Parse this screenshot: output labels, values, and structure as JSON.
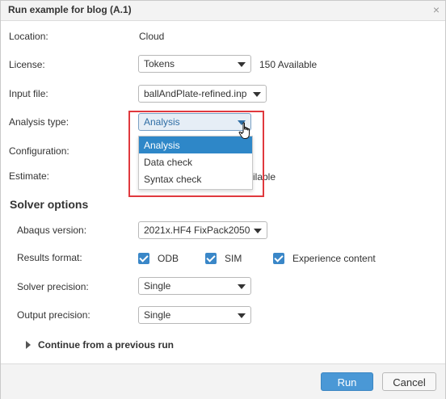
{
  "dialog": {
    "title": "Run example for blog (A.1)",
    "close_glyph": "×"
  },
  "fields": {
    "location_label": "Location:",
    "location_value": "Cloud",
    "license_label": "License:",
    "license_value": "Tokens",
    "license_available": "150 Available",
    "input_file_label": "Input file:",
    "input_file_value": "ballAndPlate-refined.inp",
    "analysis_type_label": "Analysis type:",
    "analysis_type_value": "Analysis",
    "configuration_label": "Configuration:",
    "estimate_label": "Estimate:",
    "estimate_partial_value": "ilable"
  },
  "analysis_dropdown": {
    "options": [
      "Analysis",
      "Data check",
      "Syntax check"
    ],
    "selected": "Analysis"
  },
  "solver_options": {
    "title": "Solver options",
    "abaqus_version_label": "Abaqus version:",
    "abaqus_version_value": "2021x.HF4 FixPack2050",
    "results_format_label": "Results format:",
    "results_formats": [
      {
        "label": "ODB",
        "checked": true
      },
      {
        "label": "SIM",
        "checked": true
      },
      {
        "label": "Experience content",
        "checked": true
      }
    ],
    "solver_precision_label": "Solver precision:",
    "solver_precision_value": "Single",
    "output_precision_label": "Output precision:",
    "output_precision_value": "Single"
  },
  "expander": {
    "label": "Continue from a previous run",
    "icon": "triangle-right-icon"
  },
  "footer": {
    "run_label": "Run",
    "cancel_label": "Cancel"
  },
  "colors": {
    "accent": "#4a98d6",
    "highlight_border": "#e0393e",
    "checkbox": "#3a87c8"
  }
}
